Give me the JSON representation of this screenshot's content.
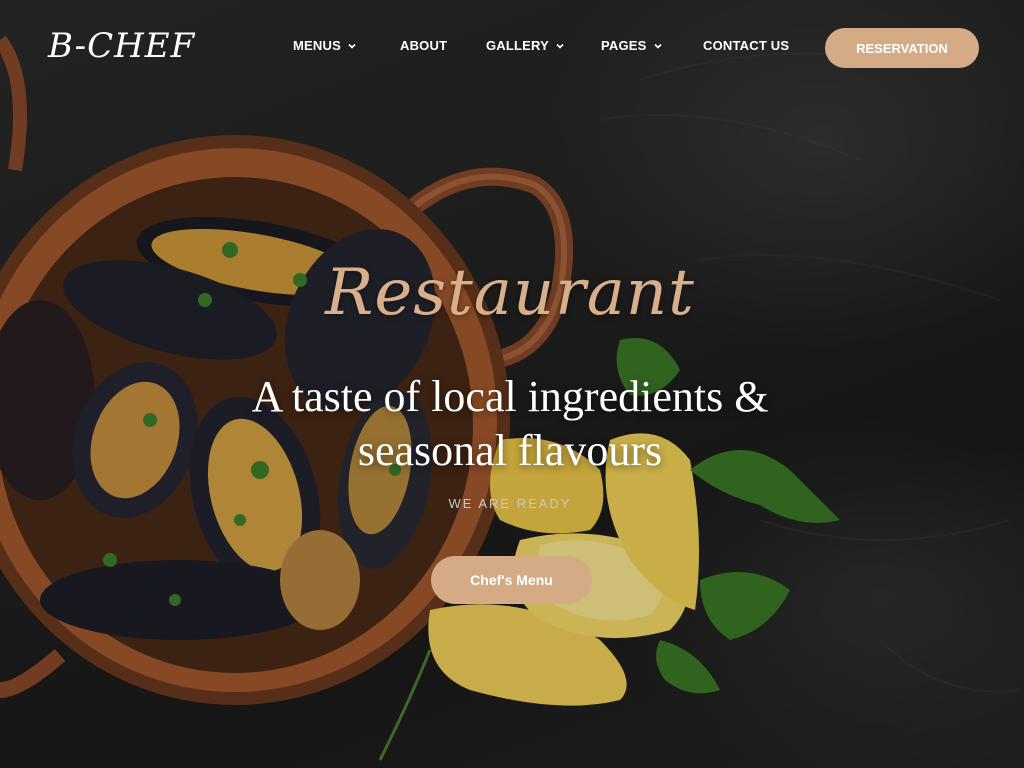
{
  "header": {
    "logo": "B-CHEF",
    "nav": [
      {
        "label": "MENUS",
        "has_dropdown": true,
        "icon": "chevron-down-icon"
      },
      {
        "label": "ABOUT",
        "has_dropdown": false
      },
      {
        "label": "GALLERY",
        "has_dropdown": true,
        "icon": "chevron-down-icon"
      },
      {
        "label": "PAGES",
        "has_dropdown": true,
        "icon": "chevron-down-icon"
      },
      {
        "label": "CONTACT US",
        "has_dropdown": false
      }
    ],
    "reservation_label": "RESERVATION"
  },
  "hero": {
    "script_title": "Restaurant",
    "headline_line1": "A taste of local ingredients &",
    "headline_line2": "seasonal flavours",
    "tagline": "WE ARE READY",
    "cta_label": "Chef's Menu",
    "image": "mussels-in-copper-pan-with-lemon-and-parsley"
  },
  "colors": {
    "accent": "#d5ab85",
    "script": "#d9ae8a",
    "background": "#1e1e1e",
    "text": "#ffffff"
  }
}
